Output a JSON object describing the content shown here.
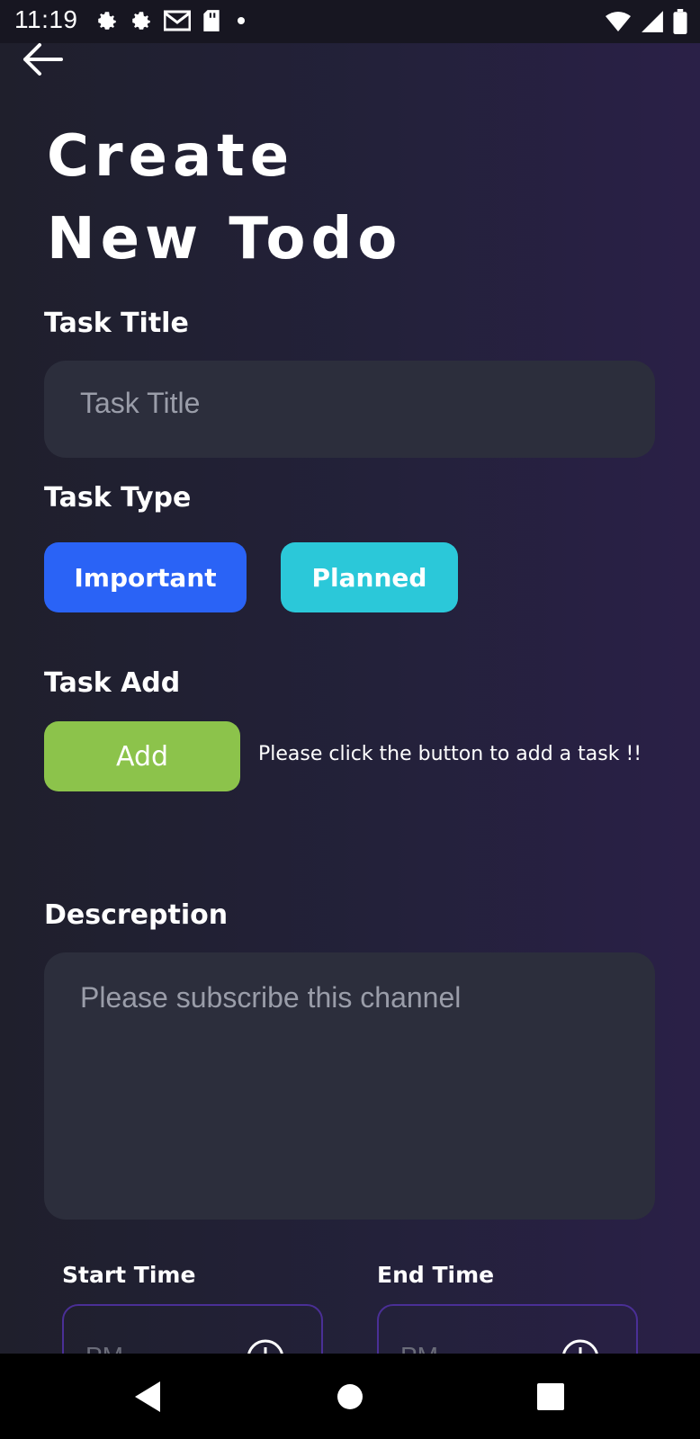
{
  "status_bar": {
    "time": "11:19",
    "left_icons": [
      "gear-icon",
      "gear-icon",
      "gmail-icon",
      "sd-card-icon",
      "dot-icon"
    ],
    "right_icons": [
      "wifi-icon",
      "signal-icon",
      "battery-icon"
    ]
  },
  "header": {
    "title_line1": "Create",
    "title_line2": "New Todo"
  },
  "form": {
    "task_title_label": "Task Title",
    "task_title_placeholder": "Task Title",
    "task_type_label": "Task Type",
    "task_types": [
      "Important",
      "Planned"
    ],
    "task_add_label": "Task Add",
    "add_button": "Add",
    "add_hint": "Please click the button to add a task !!",
    "description_label": "Descreption",
    "description_placeholder": "Please subscribe this channel",
    "start_time_label": "Start Time",
    "end_time_label": "End Time",
    "start_time_placeholder": "PM",
    "end_time_placeholder": "PM"
  },
  "colors": {
    "important": "#2a63f6",
    "planned": "#2bc8d9",
    "add": "#8cc34b",
    "input_bg": "#2c2e3c",
    "time_border": "#4a2f96"
  }
}
